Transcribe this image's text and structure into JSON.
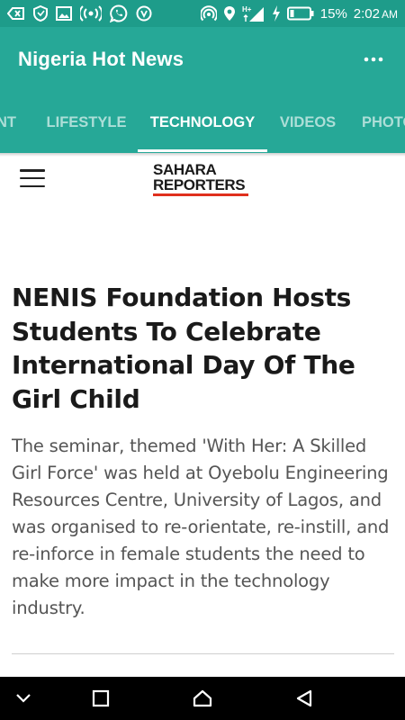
{
  "status_bar": {
    "battery_percent": "15%",
    "time": "2:02",
    "ampm": "AM",
    "network": "H+",
    "icons": [
      "back-arrow-icon",
      "shield-icon",
      "image-icon",
      "broadcast-icon",
      "whatsapp-icon",
      "vpn-icon",
      "hotspot-icon",
      "location-icon",
      "signal-icon",
      "charging-icon",
      "battery-icon"
    ]
  },
  "app_bar": {
    "title": "Nigeria Hot News",
    "more_icon": "more-vertical-icon"
  },
  "tabs": [
    {
      "label": "NT",
      "active": false
    },
    {
      "label": "LIFESTYLE",
      "active": false
    },
    {
      "label": "TECHNOLOGY",
      "active": true
    },
    {
      "label": "VIDEOS",
      "active": false
    },
    {
      "label": "PHOTO",
      "active": false
    }
  ],
  "site": {
    "menu_icon": "hamburger-menu-icon",
    "logo_line1": "SAHARA",
    "logo_line2": "REPORTERS"
  },
  "article": {
    "headline": "NENIS Foundation Hosts Students To Celebrate International Day Of The Girl Child",
    "summary": "The seminar, themed 'With Her: A Skilled Girl Force' was held at Oyebolu Engineering Resources Centre, University of Lagos, and was organised to re-orientate, re-instill, and re-inforce in female students the need to make more impact in the technology industry."
  },
  "nav_bar": {
    "icons": [
      "nav-down-icon",
      "recents-square-icon",
      "home-icon",
      "back-triangle-icon"
    ]
  },
  "colors": {
    "status_bar": "#1e9c8a",
    "app_bar": "#26a897",
    "logo_accent": "#e0301e"
  }
}
